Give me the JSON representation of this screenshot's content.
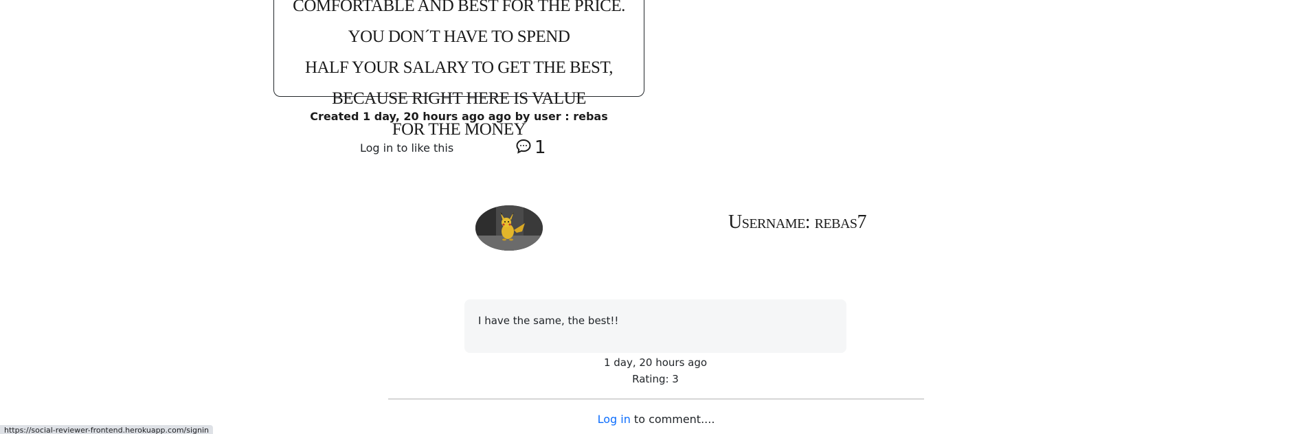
{
  "review": {
    "lines": [
      "comfortable and best for the price. You don´t have to spend",
      "half your salary to get the best, because right here is value",
      "for the money"
    ],
    "created_label": "Created 1 day, 20 hours ago ago by user : rebas"
  },
  "actions": {
    "like_text": "Log in to like this",
    "comment_count": "1",
    "comment_icon": "comment-bubble-icon"
  },
  "profile": {
    "username_label": "Username: rebas7",
    "avatar": "pikachu-avatar"
  },
  "comment": {
    "text": "I have the same, the best!!",
    "time": "1 day, 20 hours ago",
    "rating": "Rating: 3"
  },
  "footer": {
    "login_link": "Log in",
    "login_suffix": " to comment...."
  },
  "status_bar": {
    "url": "https://social-reviewer-frontend.herokuapp.com/signin"
  }
}
